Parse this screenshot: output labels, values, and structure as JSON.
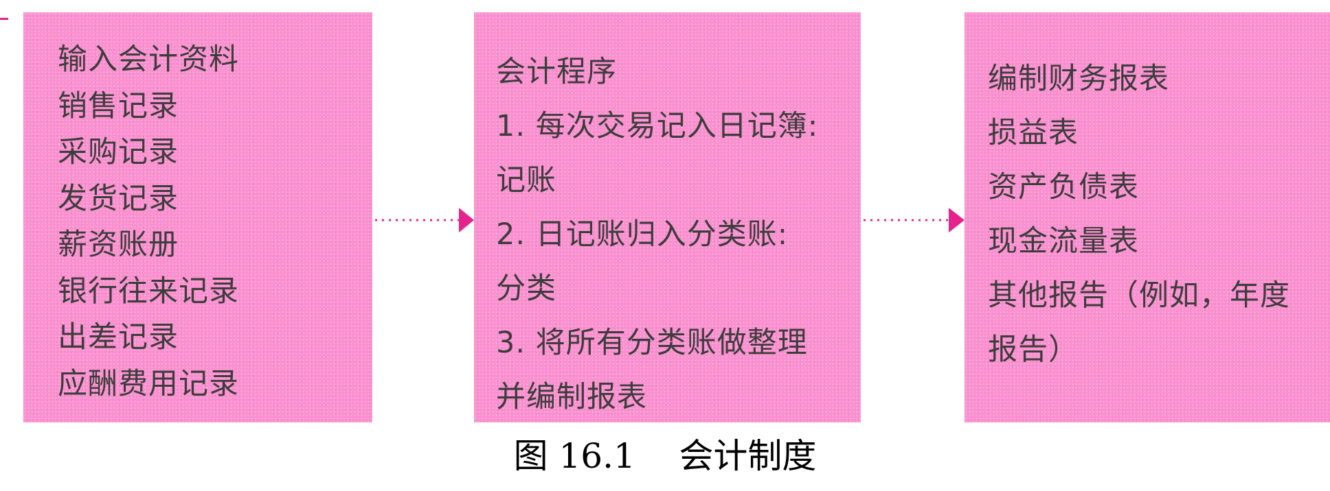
{
  "input_box": {
    "title": "输入会计资料",
    "lines": [
      "销售记录",
      "采购记录",
      "发货记录",
      "薪资账册",
      "银行往来记录",
      "出差记录",
      "应酬费用记录"
    ]
  },
  "process_box": {
    "title": "会计程序",
    "lines": [
      "1. 每次交易记入日记簿:",
      "记账",
      "2. 日记账归入分类账:",
      "分类",
      "3. 将所有分类账做整理",
      "并编制报表"
    ]
  },
  "report_box": {
    "title": "编制财务报表",
    "lines": [
      "损益表",
      "资产负债表",
      "现金流量表",
      "其他报告（例如，年度",
      "报告）"
    ]
  },
  "caption": "图 16.1    会计制度",
  "colors": {
    "box_fill": "#fb8fcf",
    "arrow": "#e4248c",
    "text": "#3d3d3d"
  }
}
